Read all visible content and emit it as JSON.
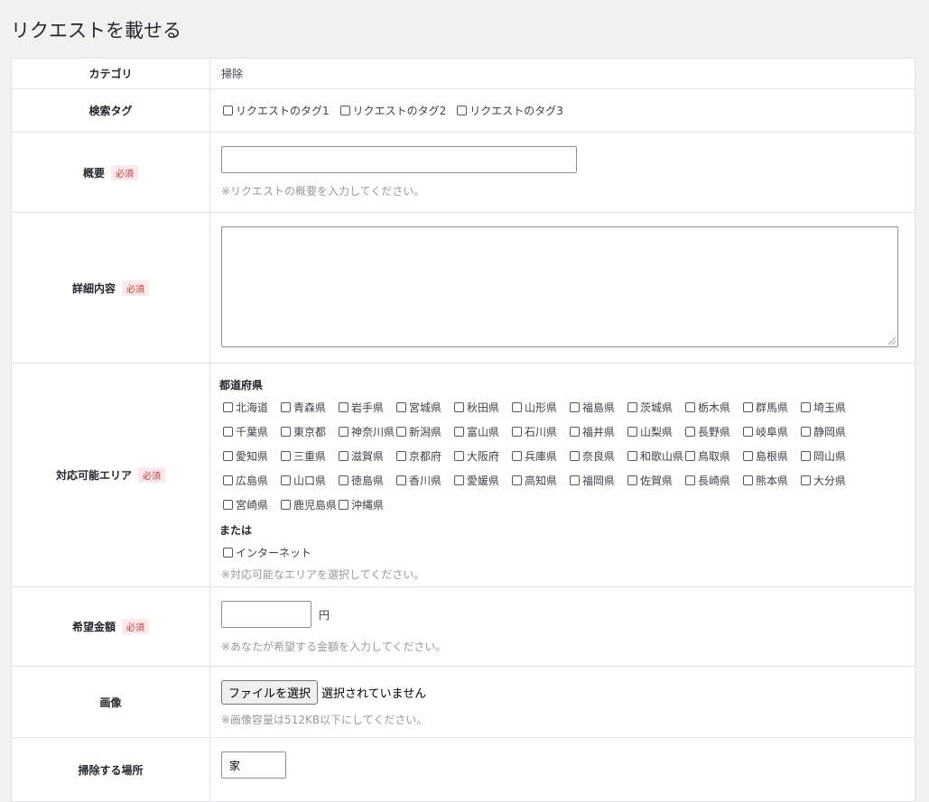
{
  "page": {
    "title": "リクエストを載せる"
  },
  "required_label": "必須",
  "category": {
    "label": "カテゴリ",
    "value": "掃除"
  },
  "tags": {
    "label": "検索タグ",
    "options": [
      "リクエストのタグ1",
      "リクエストのタグ2",
      "リクエストのタグ3"
    ]
  },
  "summary": {
    "label": "概要",
    "value": "",
    "hint": "※リクエストの概要を入力してください。"
  },
  "details": {
    "label": "詳細内容",
    "value": ""
  },
  "area": {
    "label": "対応可能エリア",
    "prefecture_heading": "都道府県",
    "prefectures": [
      "北海道",
      "青森県",
      "岩手県",
      "宮城県",
      "秋田県",
      "山形県",
      "福島県",
      "茨城県",
      "栃木県",
      "群馬県",
      "埼玉県",
      "千葉県",
      "東京都",
      "神奈川県",
      "新潟県",
      "富山県",
      "石川県",
      "福井県",
      "山梨県",
      "長野県",
      "岐阜県",
      "静岡県",
      "愛知県",
      "三重県",
      "滋賀県",
      "京都府",
      "大阪府",
      "兵庫県",
      "奈良県",
      "和歌山県",
      "鳥取県",
      "島根県",
      "岡山県",
      "広島県",
      "山口県",
      "徳島県",
      "香川県",
      "愛媛県",
      "高知県",
      "福岡県",
      "佐賀県",
      "長崎県",
      "熊本県",
      "大分県",
      "宮崎県",
      "鹿児島県",
      "沖縄県"
    ],
    "or_label": "または",
    "internet_label": "インターネット",
    "hint": "※対応可能なエリアを選択してください。"
  },
  "price": {
    "label": "希望金額",
    "value": "",
    "unit": "円",
    "hint": "※あなたが希望する金額を入力してください。"
  },
  "image": {
    "label": "画像",
    "button": "ファイルを選択",
    "status": "選択されていません",
    "hint": "※画像容量は512KB以下にしてください。"
  },
  "location": {
    "label": "掃除する場所",
    "value": "家"
  }
}
